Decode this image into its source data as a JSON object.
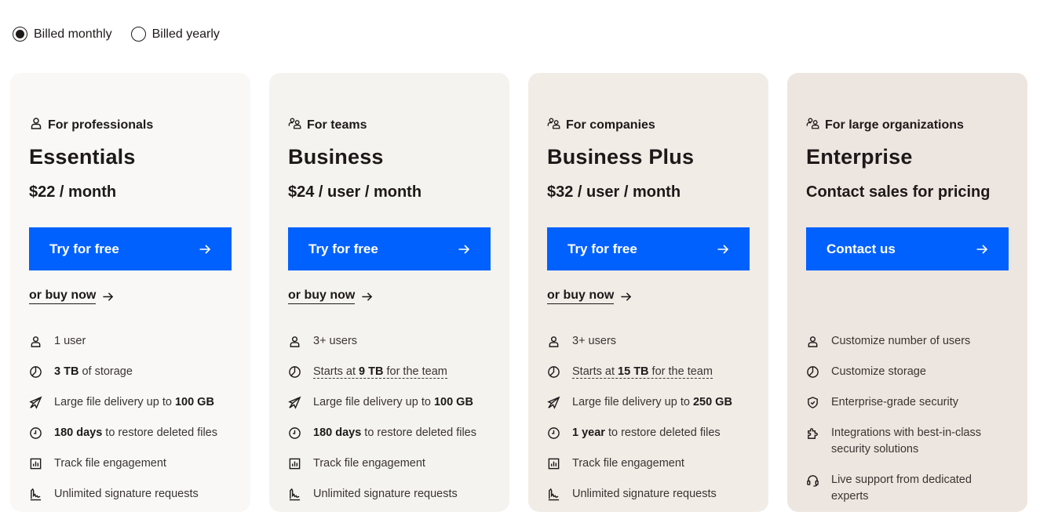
{
  "billing": {
    "monthly_label": "Billed monthly",
    "yearly_label": "Billed yearly",
    "selected": "monthly"
  },
  "colors": {
    "accent": "#0061fe",
    "text": "#1e1919",
    "card_backgrounds": [
      "#f9f8f6",
      "#f5f3f0",
      "#f1ece6",
      "#ede6e0"
    ]
  },
  "plans": [
    {
      "audience_icon": "person-icon",
      "audience": "For professionals",
      "name": "Essentials",
      "price": "$22 / month",
      "cta_label": "Try for free",
      "buy_label": "or buy now",
      "features": [
        {
          "icon": "user-icon",
          "pre": "1 user",
          "bold": "",
          "post": "",
          "dashed": false
        },
        {
          "icon": "storage-icon",
          "pre": "",
          "bold": "3 TB",
          "post": " of storage",
          "dashed": false
        },
        {
          "icon": "send-icon",
          "pre": "Large file delivery up to ",
          "bold": "100 GB",
          "post": "",
          "dashed": false
        },
        {
          "icon": "clock-icon",
          "pre": "",
          "bold": "180 days",
          "post": " to restore deleted files",
          "dashed": false
        },
        {
          "icon": "chart-icon",
          "pre": "Track file engagement",
          "bold": "",
          "post": "",
          "dashed": false
        },
        {
          "icon": "signature-icon",
          "pre": "Unlimited signature requests",
          "bold": "",
          "post": "",
          "dashed": false
        }
      ]
    },
    {
      "audience_icon": "team-icon",
      "audience": "For teams",
      "name": "Business",
      "price": "$24 / user / month",
      "cta_label": "Try for free",
      "buy_label": "or buy now",
      "features": [
        {
          "icon": "user-icon",
          "pre": "3+ users",
          "bold": "",
          "post": "",
          "dashed": false
        },
        {
          "icon": "storage-icon",
          "pre": "Starts at ",
          "bold": "9 TB",
          "post": " for the team",
          "dashed": true
        },
        {
          "icon": "send-icon",
          "pre": "Large file delivery up to ",
          "bold": "100 GB",
          "post": "",
          "dashed": false
        },
        {
          "icon": "clock-icon",
          "pre": "",
          "bold": "180 days",
          "post": " to restore deleted files",
          "dashed": false
        },
        {
          "icon": "chart-icon",
          "pre": "Track file engagement",
          "bold": "",
          "post": "",
          "dashed": false
        },
        {
          "icon": "signature-icon",
          "pre": "Unlimited signature requests",
          "bold": "",
          "post": "",
          "dashed": false
        }
      ]
    },
    {
      "audience_icon": "team-icon",
      "audience": "For companies",
      "name": "Business Plus",
      "price": "$32 / user / month",
      "cta_label": "Try for free",
      "buy_label": "or buy now",
      "features": [
        {
          "icon": "user-icon",
          "pre": "3+ users",
          "bold": "",
          "post": "",
          "dashed": false
        },
        {
          "icon": "storage-icon",
          "pre": "Starts at ",
          "bold": "15 TB",
          "post": " for the team",
          "dashed": true
        },
        {
          "icon": "send-icon",
          "pre": "Large file delivery up to ",
          "bold": "250 GB",
          "post": "",
          "dashed": false
        },
        {
          "icon": "clock-icon",
          "pre": "",
          "bold": "1 year",
          "post": " to restore deleted files",
          "dashed": false
        },
        {
          "icon": "chart-icon",
          "pre": "Track file engagement",
          "bold": "",
          "post": "",
          "dashed": false
        },
        {
          "icon": "signature-icon",
          "pre": "Unlimited signature requests",
          "bold": "",
          "post": "",
          "dashed": false
        }
      ]
    },
    {
      "audience_icon": "team-icon",
      "audience": "For large organizations",
      "name": "Enterprise",
      "price": "Contact sales for pricing",
      "cta_label": "Contact us",
      "buy_label": "",
      "features": [
        {
          "icon": "user-icon",
          "pre": "Customize number of users",
          "bold": "",
          "post": "",
          "dashed": false
        },
        {
          "icon": "storage-icon",
          "pre": "Customize storage",
          "bold": "",
          "post": "",
          "dashed": false
        },
        {
          "icon": "shield-icon",
          "pre": "Enterprise-grade security",
          "bold": "",
          "post": "",
          "dashed": false
        },
        {
          "icon": "puzzle-icon",
          "pre": "Integrations with best-in-class security solutions",
          "bold": "",
          "post": "",
          "dashed": false
        },
        {
          "icon": "headset-icon",
          "pre": "Live support from dedicated experts",
          "bold": "",
          "post": "",
          "dashed": false
        }
      ]
    }
  ]
}
